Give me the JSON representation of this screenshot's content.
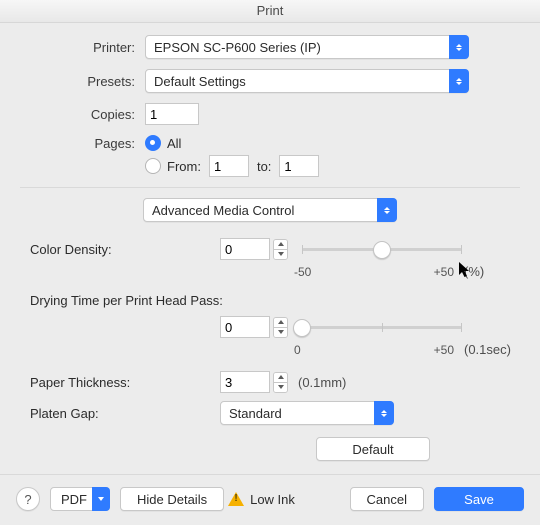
{
  "window": {
    "title": "Print"
  },
  "labels": {
    "printer": "Printer:",
    "presets": "Presets:",
    "copies": "Copies:",
    "pages": "Pages:",
    "all": "All",
    "from": "From:",
    "to": "to:"
  },
  "printer": {
    "selected": "EPSON SC-P600 Series (IP)"
  },
  "presets": {
    "selected": "Default Settings"
  },
  "copies": {
    "value": "1"
  },
  "pages": {
    "mode": "all",
    "from": "1",
    "to": "1"
  },
  "panel": {
    "selected": "Advanced Media Control"
  },
  "advanced": {
    "colorDensity": {
      "label": "Color Density:",
      "value": "0",
      "scaleMin": "-50",
      "scaleMax": "+50",
      "unit": "(%)"
    },
    "dryingTime": {
      "label": "Drying Time per Print Head Pass:",
      "value": "0",
      "scaleMin": "0",
      "scaleMax": "+50",
      "unit": "(0.1sec)"
    },
    "paperThickness": {
      "label": "Paper Thickness:",
      "value": "3",
      "unit": "(0.1mm)"
    },
    "platenGap": {
      "label": "Platen Gap:",
      "selected": "Standard"
    },
    "defaultButton": "Default"
  },
  "footer": {
    "pdf": "PDF",
    "hideDetails": "Hide Details",
    "statusText": "Low Ink",
    "cancel": "Cancel",
    "save": "Save"
  }
}
